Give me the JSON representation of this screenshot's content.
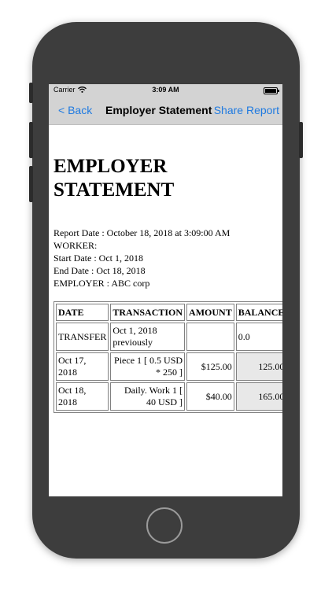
{
  "status_bar": {
    "carrier": "Carrier",
    "time": "3:09 AM"
  },
  "nav": {
    "back_label": "< Back",
    "title": "Employer Statement",
    "share_label": "Share Report"
  },
  "report": {
    "title_line1": "EMPLOYER",
    "title_line2": "STATEMENT",
    "info_lines": [
      "Report Date : October 18, 2018 at 3:09:00 AM",
      "WORKER:",
      "Start Date : Oct 1, 2018",
      "End Date : Oct 18, 2018",
      "EMPLOYER : ABC corp"
    ]
  },
  "table": {
    "headers": [
      "DATE",
      "TRANSACTION",
      "AMOUNT",
      "BALANCE"
    ],
    "rows": [
      {
        "date": "TRANSFER",
        "transaction": "Oct 1, 2018 previously",
        "amount": "",
        "balance": "0.0"
      },
      {
        "date": "Oct 17, 2018",
        "transaction": "Piece 1 [ 0.5 USD * 250 ]",
        "amount": "$125.00",
        "balance": "125.00"
      },
      {
        "date": "Oct 18, 2018",
        "transaction": "Daily. Work 1 [ 40 USD ]",
        "amount": "$40.00",
        "balance": "165.00"
      }
    ]
  }
}
